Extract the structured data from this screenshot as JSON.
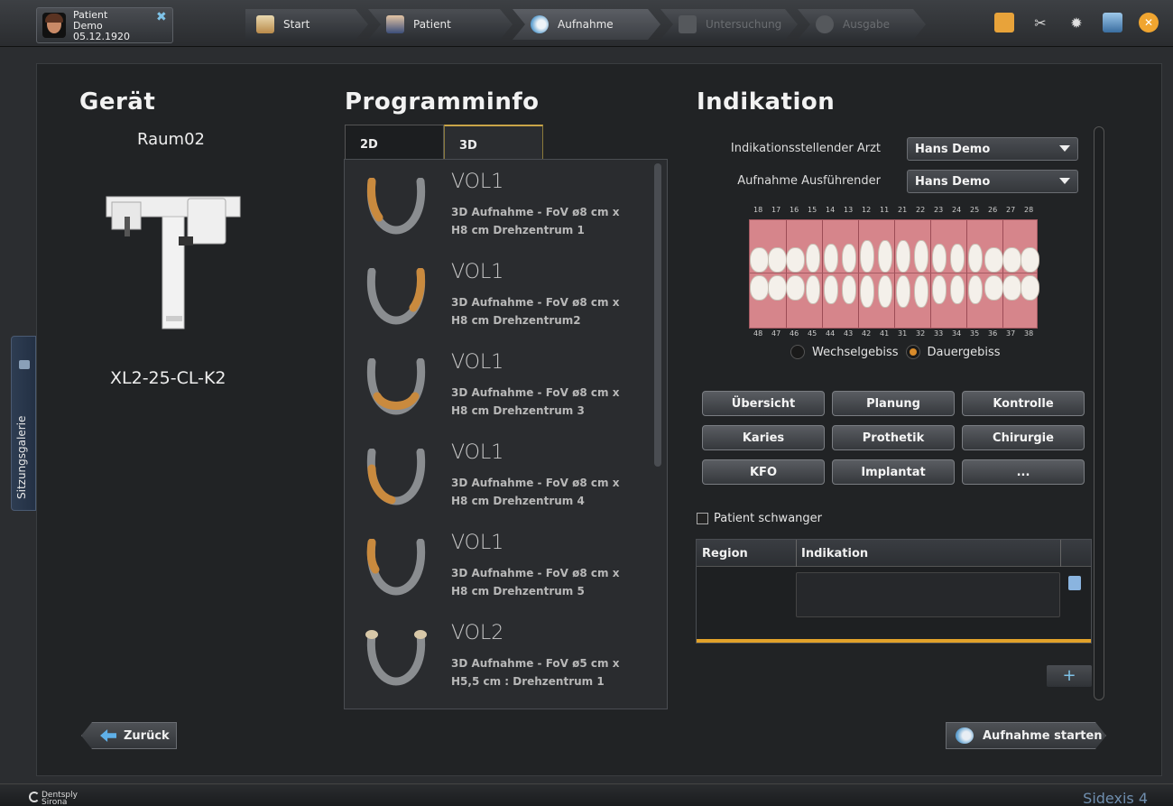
{
  "patient": {
    "first_name": "Patient",
    "last_name": "Demo",
    "birthdate": "05.12.1920"
  },
  "workflow": {
    "steps": [
      {
        "label": "Start",
        "state": "done"
      },
      {
        "label": "Patient",
        "state": "done"
      },
      {
        "label": "Aufnahme",
        "state": "active"
      },
      {
        "label": "Untersuchung",
        "state": "disabled"
      },
      {
        "label": "Ausgabe",
        "state": "disabled"
      }
    ]
  },
  "toolbar": {
    "icons": [
      "notes-icon",
      "tools-icon",
      "settings-icon",
      "window-icon",
      "close-icon"
    ]
  },
  "side_tab": {
    "label": "Sitzungsgalerie"
  },
  "device": {
    "title": "Gerät",
    "room": "Raum02",
    "model": "XL2-25-CL-K2"
  },
  "program": {
    "title": "Programminfo",
    "tabs": [
      {
        "label": "2D"
      },
      {
        "label": "3D",
        "active": true
      }
    ],
    "items": [
      {
        "name": "VOL1",
        "line1": "3D Aufnahme - FoV ø8 cm x",
        "line2": "H8 cm Drehzentrum 1",
        "highlight": "left"
      },
      {
        "name": "VOL1",
        "line1": "3D Aufnahme - FoV ø8 cm x",
        "line2": "H8 cm Drehzentrum2",
        "highlight": "right"
      },
      {
        "name": "VOL1",
        "line1": "3D Aufnahme - FoV ø8 cm x",
        "line2": "H8 cm Drehzentrum 3",
        "highlight": "front"
      },
      {
        "name": "VOL1",
        "line1": "3D Aufnahme - FoV ø8 cm x",
        "line2": "H8 cm Drehzentrum 4",
        "highlight": "left-lower"
      },
      {
        "name": "VOL1",
        "line1": "3D Aufnahme - FoV ø8 cm x",
        "line2": "H8 cm Drehzentrum 5",
        "highlight": "upper-left"
      },
      {
        "name": "VOL2",
        "line1": "3D Aufnahme - FoV ø5 cm x",
        "line2": "H5,5 cm : Drehzentrum 1",
        "highlight": "joints"
      }
    ]
  },
  "indication": {
    "title": "Indikation",
    "doctor_label": "Indikationsstellender Arzt",
    "doctor_value": "Hans Demo",
    "operator_label": "Aufnahme Ausführender",
    "operator_value": "Hans Demo",
    "upper_teeth": [
      "18",
      "17",
      "16",
      "15",
      "14",
      "13",
      "12",
      "11",
      "21",
      "22",
      "23",
      "24",
      "25",
      "26",
      "27",
      "28"
    ],
    "lower_teeth": [
      "48",
      "47",
      "46",
      "45",
      "44",
      "43",
      "42",
      "41",
      "31",
      "32",
      "33",
      "34",
      "35",
      "36",
      "37",
      "38"
    ],
    "dentition_options": [
      {
        "label": "Wechselgebiss",
        "selected": false
      },
      {
        "label": "Dauergebiss",
        "selected": true
      }
    ],
    "buttons": [
      "Übersicht",
      "Planung",
      "Kontrolle",
      "Karies",
      "Prothetik",
      "Chirurgie",
      "KFO",
      "Implantat",
      "..."
    ],
    "pregnant_label": "Patient schwanger",
    "table_headers": [
      "Region",
      "Indikation"
    ]
  },
  "actions": {
    "back": "Zurück",
    "start": "Aufnahme starten"
  },
  "footer": {
    "brand_line1": "Dentsply",
    "brand_line2": "Sirona",
    "product": "Sidexis 4"
  },
  "colors": {
    "accent_orange": "#e2a22a",
    "accent_blue": "#5fb0e8",
    "gum_pink": "#d6858b"
  }
}
